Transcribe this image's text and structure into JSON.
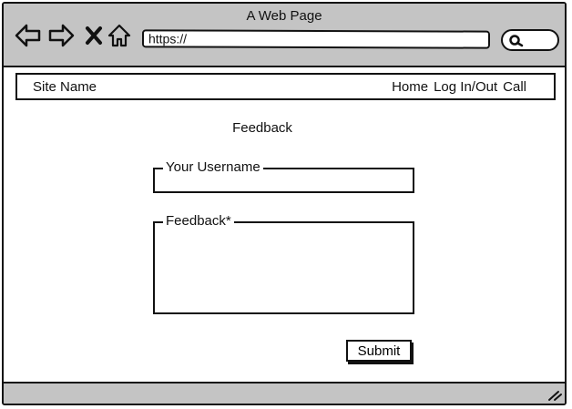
{
  "window": {
    "title": "A Web Page"
  },
  "browser": {
    "url": "https://",
    "icons": [
      "back-arrow-icon",
      "forward-arrow-icon",
      "close-x-icon",
      "home-icon",
      "search-icon",
      "resize-grip-icon"
    ]
  },
  "navbar": {
    "site_name": "Site Name",
    "links": [
      "Home",
      "Log In/Out",
      "Call"
    ]
  },
  "form": {
    "title": "Feedback",
    "username_label": "Your Username",
    "username_value": "",
    "feedback_label": "Feedback*",
    "feedback_value": "",
    "submit_label": "Submit"
  },
  "colors": {
    "chrome_gray": "#c4c4c4",
    "ink": "#111111",
    "background": "#ffffff"
  }
}
